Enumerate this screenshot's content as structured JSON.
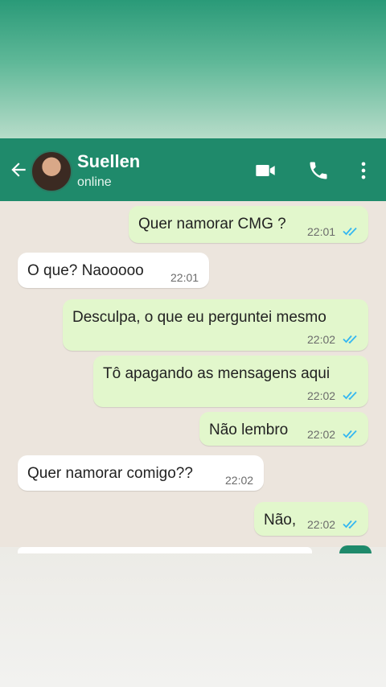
{
  "contact": {
    "name": "Suellen",
    "status": "online"
  },
  "messages": [
    {
      "text": "Quer namorar CMG ?",
      "time": "22:01",
      "direction": "out"
    },
    {
      "text": "O que? Naooooo",
      "time": "22:01",
      "direction": "in"
    },
    {
      "text": "Desculpa, o que eu perguntei mesmo",
      "time": "22:02",
      "direction": "out"
    },
    {
      "text": "Tô apagando as mensagens aqui",
      "time": "22:02",
      "direction": "out"
    },
    {
      "text": "Não lembro",
      "time": "22:02",
      "direction": "out"
    },
    {
      "text": "Quer namorar comigo??",
      "time": "22:02",
      "direction": "in"
    },
    {
      "text": "Não,",
      "time": "22:02",
      "direction": "out"
    }
  ],
  "icons": {
    "back": "arrow-left-icon",
    "video": "video-camera-icon",
    "call": "phone-icon",
    "menu": "more-vertical-icon",
    "read": "double-check-icon"
  },
  "colors": {
    "header": "#1f8a6b",
    "outgoing_bubble": "#e2f7cc",
    "incoming_bubble": "#ffffff",
    "read_ticks": "#34b7f1",
    "chat_background": "#ece5dd"
  }
}
